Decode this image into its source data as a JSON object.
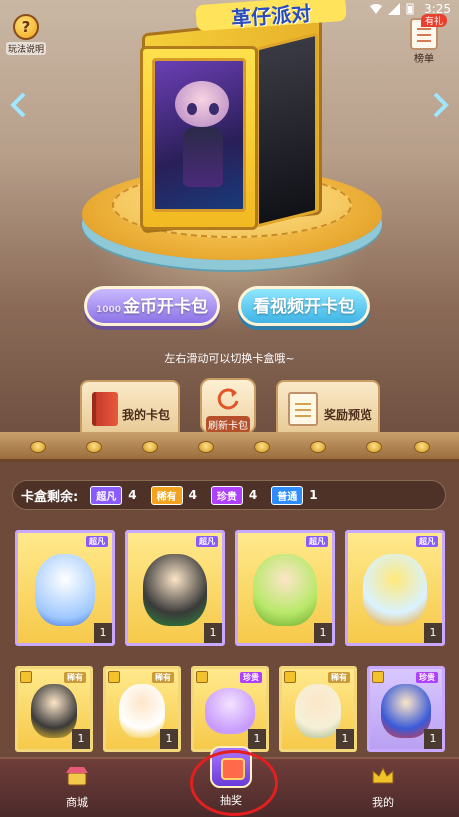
{
  "status_bar": {
    "time": "3:25"
  },
  "top_bar": {
    "help_label": "玩法说明",
    "list_label": "榜单",
    "list_badge": "有礼"
  },
  "card_box": {
    "title": "革仔派对"
  },
  "actions": {
    "coin_button_small": "1000",
    "coin_button": "金币开卡包",
    "video_button": "看视频开卡包"
  },
  "hint": "左右滑动可以切换卡盒哦~",
  "tabs": {
    "my_packs": "我的卡包",
    "refresh": "刷新卡包",
    "reward_preview": "奖励预览"
  },
  "remaining": {
    "title": "卡盒剩余:",
    "items": [
      {
        "rarity": "超凡",
        "count": "4",
        "color": "#8a5cff"
      },
      {
        "rarity": "稀有",
        "count": "4",
        "color": "#f2a21e"
      },
      {
        "rarity": "珍贵",
        "count": "4",
        "color": "#b040ff"
      },
      {
        "rarity": "普通",
        "count": "1",
        "color": "#2f8cff"
      }
    ]
  },
  "cards_row1": [
    {
      "tag": "超凡",
      "count": "1"
    },
    {
      "tag": "超凡",
      "count": "1"
    },
    {
      "tag": "超凡",
      "count": "1"
    },
    {
      "tag": "超凡",
      "count": "1"
    }
  ],
  "cards_row2": [
    {
      "tag": "稀有",
      "count": "1"
    },
    {
      "tag": "稀有",
      "count": "1"
    },
    {
      "tag": "珍贵",
      "count": "1"
    },
    {
      "tag": "稀有",
      "count": "1"
    },
    {
      "tag": "珍贵",
      "count": "1"
    }
  ],
  "bottom_nav": {
    "shop": "商城",
    "lottery": "抽奖",
    "mine": "我的"
  }
}
